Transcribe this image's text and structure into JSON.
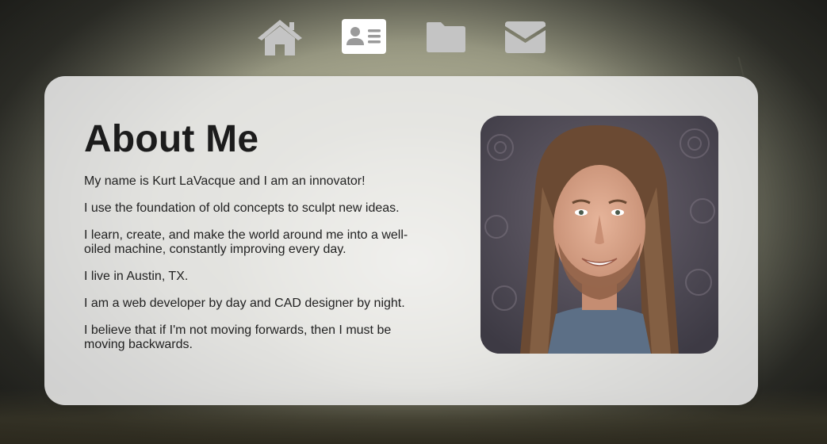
{
  "nav": {
    "items": [
      {
        "icon": "home-icon",
        "active": false
      },
      {
        "icon": "id-card-icon",
        "active": true
      },
      {
        "icon": "folder-icon",
        "active": false
      },
      {
        "icon": "envelope-icon",
        "active": false
      }
    ]
  },
  "about": {
    "title": "About Me",
    "paragraphs": [
      "My name is Kurt LaVacque and I am an innovator!",
      "I use the foundation of old concepts to sculpt new ideas.",
      "I learn, create, and make the world around me into a well-oiled machine, constantly improving every day.",
      "I live in Austin, TX.",
      "I am a web developer by day and CAD designer by night.",
      "I believe that if I'm not moving forwards, then I must be moving backwards."
    ]
  },
  "colors": {
    "nav_icon_inactive": "#c4c4c4",
    "nav_icon_active": "#9a9a9a",
    "card_background": "#eeeeee",
    "text": "#222222"
  }
}
